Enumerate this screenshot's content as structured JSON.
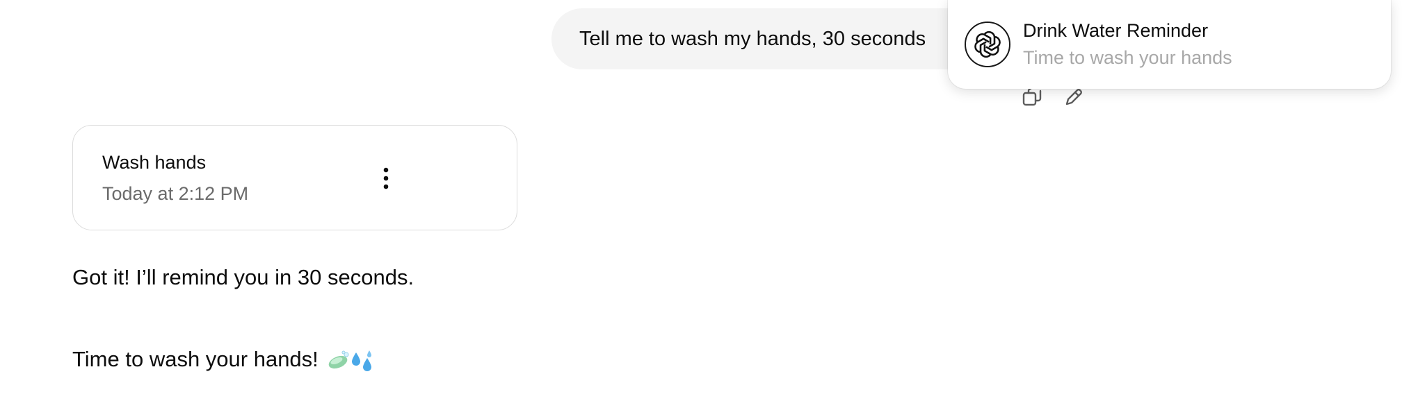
{
  "conversation": {
    "user_message": "Tell me to wash my hands, 30 seconds"
  },
  "notification": {
    "title": "Drink Water Reminder",
    "body": "Time to wash your hands",
    "icon": "openai-logo-icon"
  },
  "task_card": {
    "title": "Wash hands",
    "time": "Today at 2:12 PM",
    "menu_icon": "more-vertical-icon"
  },
  "assistant": {
    "confirmation": "Got it! I’ll remind you in 30 seconds.",
    "reminder": "Time to wash your hands!",
    "reminder_emojis": [
      "soap-icon",
      "sweat-droplets-icon"
    ]
  },
  "message_actions": [
    "copy-icon",
    "edit-pencil-icon"
  ],
  "colors": {
    "user_bubble": "#f4f4f4",
    "notification_body": "#a8a8a8",
    "card_border": "#dcdcdc",
    "secondary_text": "#6b6b6b"
  }
}
